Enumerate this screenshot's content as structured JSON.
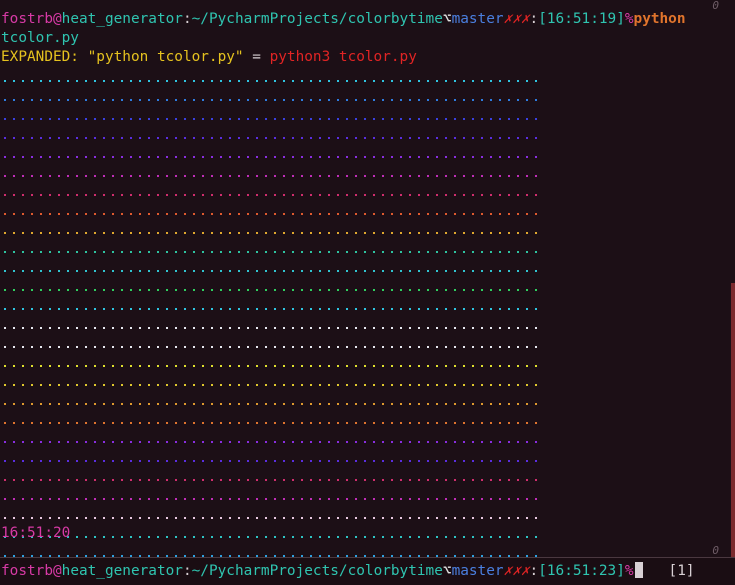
{
  "prompt": {
    "user": "fostrb",
    "at": "@",
    "host": "heat_generator",
    "colon": ":",
    "path": "~/PycharmProjects/colorbytime",
    "branch_icon": "⌥",
    "branch": "master",
    "dirty": "✗✗✗",
    "sep": ":",
    "time": "[16:51:19]",
    "pct": "%",
    "command": "python"
  },
  "wrapped_arg": "tcolor.py",
  "expanded": {
    "label": "EXPANDED: ",
    "original": "\"python tcolor.py\"",
    "equals": " = ",
    "new": "python3 tcolor.py"
  },
  "dot_rows": {
    "colors": [
      "#2fc4e0",
      "#2e7ce0",
      "#3a40e0",
      "#5b2ee0",
      "#8a2ee0",
      "#c02eb8",
      "#d02e6e",
      "#e05a2e",
      "#e0a82e",
      "#2ec4a0",
      "#30c4d0",
      "#2ed060",
      "#2ec4e0",
      "#e8e8f0",
      "#e8e8f0",
      "#e0e02e",
      "#e0c82e",
      "#e09a2e",
      "#e0742e",
      "#8a2ee0",
      "#5b2ee0",
      "#d02e6e",
      "#c02eb8",
      "#e8c8e0",
      "#2ec4c4",
      "#2ea0e0",
      "#2e7ce0"
    ]
  },
  "clock": "16:51:20",
  "markers": {
    "top": "0",
    "bottom": "0"
  },
  "bottom_prompt": {
    "user": "fostrb",
    "at": "@",
    "host": "heat_generator",
    "colon": ":",
    "path": "~/PycharmProjects/colorbytime",
    "branch_icon": "⌥",
    "branch": "master",
    "dirty": "✗✗✗",
    "sep": ":",
    "time": "[16:51:23]",
    "pct": "%",
    "jobs": "[1]"
  },
  "colors": {
    "background": "#1c0f16",
    "scroll_thumb": "#7a2a2e"
  }
}
